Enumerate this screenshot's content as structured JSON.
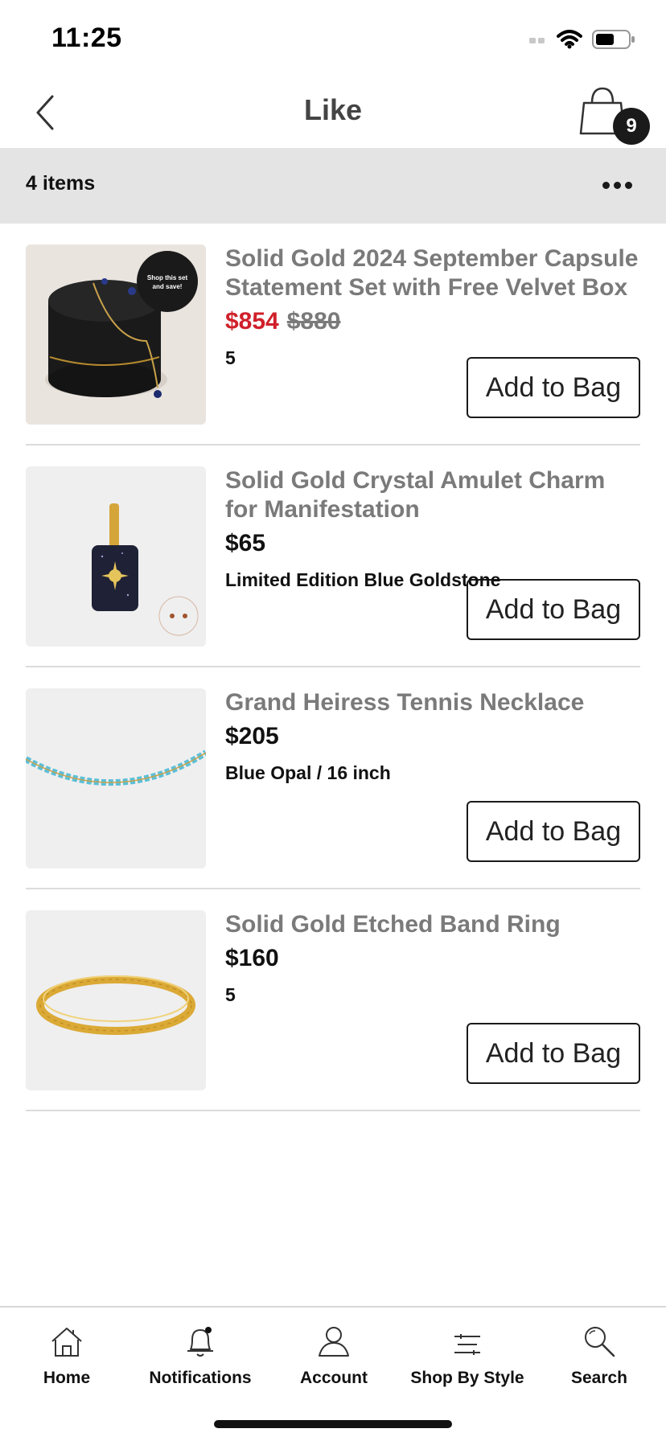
{
  "status_bar": {
    "time": "11:25"
  },
  "nav": {
    "title": "Like",
    "cart_count": "9"
  },
  "list_header": {
    "items_label": "4 items"
  },
  "products": [
    {
      "name": "Solid Gold 2024 September Capsule Statement Set with Free Velvet Box",
      "sale_price": "$854",
      "original_price": "$880",
      "variant": "5",
      "button": "Add to Bag",
      "image_badge_line1": "Shop this set",
      "image_badge_line2": "and save!"
    },
    {
      "name": "Solid Gold Crystal Amulet Charm for Manifestation",
      "price": "$65",
      "variant": "Limited Edition Blue Goldstone",
      "button": "Add to Bag"
    },
    {
      "name": "Grand Heiress Tennis Necklace",
      "price": "$205",
      "variant": "Blue Opal / 16 inch",
      "button": "Add to Bag"
    },
    {
      "name": "Solid Gold Etched Band Ring",
      "price": "$160",
      "variant": "5",
      "button": "Add to Bag"
    }
  ],
  "tabs": [
    {
      "label": "Home",
      "icon": "home-icon"
    },
    {
      "label": "Notifications",
      "icon": "bell-icon"
    },
    {
      "label": "Account",
      "icon": "user-icon"
    },
    {
      "label": "Shop By Style",
      "icon": "style-icon"
    },
    {
      "label": "Search",
      "icon": "search-icon"
    }
  ],
  "colors": {
    "sale": "#d0202a",
    "muted_text": "#7a7a7a",
    "header_bg": "#e4e4e4",
    "badge_bg": "#1a1a1a"
  }
}
